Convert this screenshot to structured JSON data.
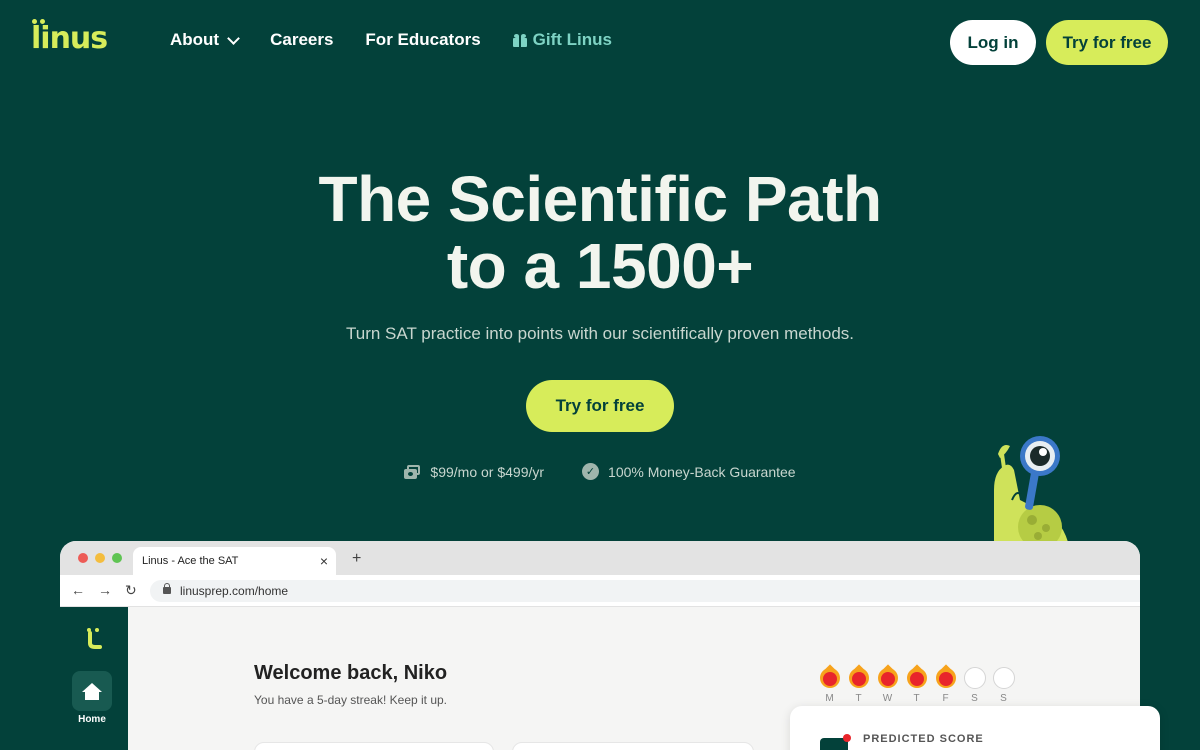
{
  "brand": {
    "logo_text": "linus"
  },
  "nav": {
    "items": [
      {
        "label": "About"
      },
      {
        "label": "Careers"
      },
      {
        "label": "For Educators"
      },
      {
        "label": "Gift Linus"
      }
    ],
    "login_label": "Log in",
    "try_label": "Try for free"
  },
  "hero": {
    "title_line1": "The Scientific Path",
    "title_line2": "to a 1500+",
    "subtitle": "Turn SAT practice into points with our scientifically proven methods.",
    "cta_label": "Try for free",
    "price_text": "$99/mo or $499/yr",
    "guarantee_text": "100% Money-Back Guarantee"
  },
  "browser": {
    "tab_title": "Linus - Ace the SAT",
    "url": "linusprep.com/home"
  },
  "app": {
    "sidebar_home_label": "Home",
    "welcome": "Welcome back, Niko",
    "streak_text": "You have a 5-day streak! Keep it up.",
    "days": [
      {
        "label": "M",
        "done": true
      },
      {
        "label": "T",
        "done": true
      },
      {
        "label": "W",
        "done": true
      },
      {
        "label": "T",
        "done": true
      },
      {
        "label": "F",
        "done": true
      },
      {
        "label": "S",
        "done": false
      },
      {
        "label": "S",
        "done": false
      }
    ],
    "score_card_label": "PREDICTED SCORE"
  },
  "colors": {
    "background": "#03413a",
    "accent": "#d7ec5a",
    "gift": "#7ed3c4",
    "flame": "#e8252b"
  }
}
